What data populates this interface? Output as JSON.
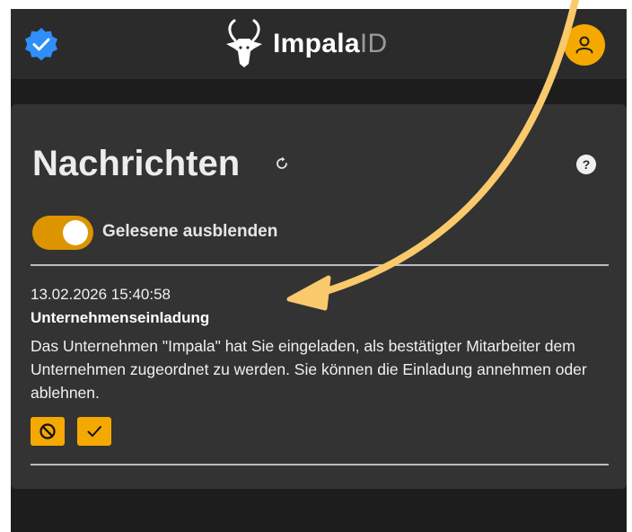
{
  "header": {
    "brand_bold": "Impala",
    "brand_light": "ID",
    "verified_icon": "verified-badge-icon",
    "profile_icon": "user-icon"
  },
  "messages_panel": {
    "title": "Nachrichten",
    "refresh_icon": "refresh-icon",
    "help_label": "?",
    "hide_read": {
      "label": "Gelesene ausblenden",
      "enabled": true
    },
    "items": [
      {
        "date": "13.02.2026 15:40:58",
        "title": "Unternehmenseinladung",
        "body": "Das Unternehmen \"Impala\" hat Sie eingeladen, als bestätigter Mitarbeiter dem Unternehmen zugeordnet zu werden. Sie können die Einladung annehmen oder ablehnen.",
        "actions": [
          {
            "icon": "decline-icon"
          },
          {
            "icon": "accept-icon"
          }
        ]
      }
    ]
  },
  "colors": {
    "accent": "#f5a800",
    "toggle_on": "#dc9400",
    "verified_blue": "#2f8ef7",
    "annotation_arrow": "#f9c96b"
  }
}
